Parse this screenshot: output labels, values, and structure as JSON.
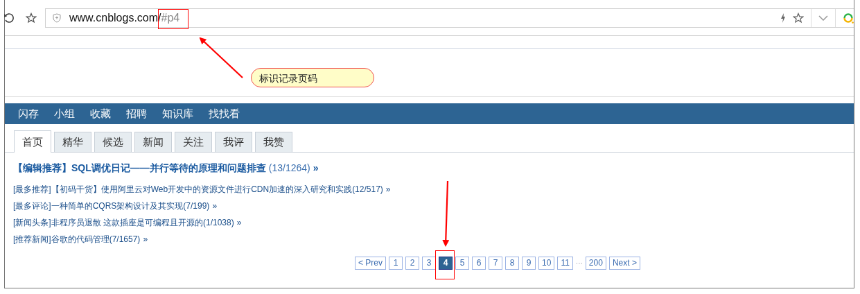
{
  "address_bar": {
    "url": "www.cnblogs.com/",
    "hash": "#p4"
  },
  "callout": {
    "text": "标识记录页码"
  },
  "nav": {
    "items": [
      "闪存",
      "小组",
      "收藏",
      "招聘",
      "知识库",
      "找找看"
    ]
  },
  "tabs": [
    {
      "label": "首页",
      "selected": true
    },
    {
      "label": "精华",
      "selected": false
    },
    {
      "label": "候选",
      "selected": false
    },
    {
      "label": "新闻",
      "selected": false
    },
    {
      "label": "关注",
      "selected": false
    },
    {
      "label": "我评",
      "selected": false
    },
    {
      "label": "我赞",
      "selected": false
    }
  ],
  "headline": {
    "title": "【编辑推荐】SQL调优日记——并行等待的原理和问题排查",
    "count": "(13/1264)",
    "more": "»"
  },
  "posts": [
    {
      "title": "[最多推荐]【初码干货】使用阿里云对Web开发中的资源文件进行CDN加速的深入研究和实践",
      "count": "(12/517)",
      "more": "»"
    },
    {
      "title": "[最多评论]一种简单的CQRS架构设计及其实现",
      "count": "(7/199)",
      "more": "»"
    },
    {
      "title": "[新闻头条]非程序员退散 这款插座是可编程且开源的",
      "count": "(1/1038)",
      "more": "»"
    },
    {
      "title": "[推荐新闻]谷歌的代码管理",
      "count": "(7/1657)",
      "more": "»"
    }
  ],
  "pagination": [
    {
      "kind": "prev",
      "label": "< Prev",
      "selected": false
    },
    {
      "kind": "page",
      "label": "1",
      "selected": false
    },
    {
      "kind": "page",
      "label": "2",
      "selected": false
    },
    {
      "kind": "page",
      "label": "3",
      "selected": false
    },
    {
      "kind": "page",
      "label": "4",
      "selected": true
    },
    {
      "kind": "page",
      "label": "5",
      "selected": false
    },
    {
      "kind": "page",
      "label": "6",
      "selected": false
    },
    {
      "kind": "page",
      "label": "7",
      "selected": false
    },
    {
      "kind": "page",
      "label": "8",
      "selected": false
    },
    {
      "kind": "page",
      "label": "9",
      "selected": false
    },
    {
      "kind": "page",
      "label": "10",
      "selected": false
    },
    {
      "kind": "page",
      "label": "11",
      "selected": false
    },
    {
      "kind": "ellipsis",
      "label": "···",
      "selected": false
    },
    {
      "kind": "page",
      "label": "200",
      "selected": false
    },
    {
      "kind": "next",
      "label": "Next >",
      "selected": false
    }
  ]
}
